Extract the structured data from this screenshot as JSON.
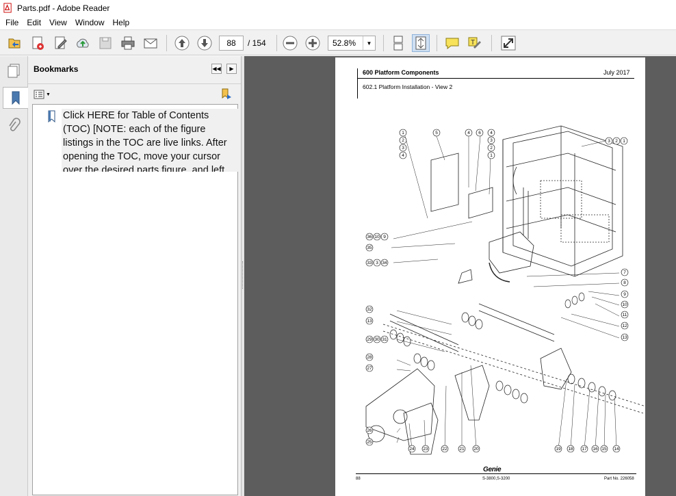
{
  "window": {
    "title": "Parts.pdf - Adobe Reader"
  },
  "menu": [
    "File",
    "Edit",
    "View",
    "Window",
    "Help"
  ],
  "toolbar": {
    "page_current": "88",
    "page_total": "/ 154",
    "zoom": "52.8%",
    "icons": [
      "open-icon",
      "create-pdf-icon",
      "edit-icon",
      "upload-icon",
      "save-icon",
      "print-icon",
      "email-icon",
      "prev-page-icon",
      "next-page-icon",
      "zoom-out-icon",
      "zoom-in-icon",
      "scroll-mode-icon",
      "fit-page-icon",
      "comment-icon",
      "sign-icon",
      "expand-icon"
    ]
  },
  "sidebar": {
    "title": "Bookmarks",
    "bookmark_text": "Click HERE for Table of Contents (TOC) [NOTE: each of the figure listings in the TOC are live links. After opening the TOC, move your cursor over the desired parts figure, and left click to"
  },
  "document": {
    "header_left": "600 Platform Components",
    "header_right": "July 2017",
    "subheader": "602.1 Platform Installation - View 2",
    "footer_left": "88",
    "footer_mid": "S-3800,S-3200",
    "footer_right": "Part No. 226058",
    "brand": "Genie",
    "callouts_top_left": [
      "1",
      "2",
      "3",
      "4"
    ],
    "callouts_top": [
      "5",
      "4",
      "6",
      "4",
      "3",
      "2",
      "1"
    ],
    "callout_top_right": [
      "3",
      "2",
      "1"
    ],
    "callouts_left": [
      "36",
      "10",
      "9",
      "35",
      "33",
      "3",
      "34",
      "32",
      "13",
      "29",
      "30",
      "31",
      "28",
      "27",
      "26",
      "25"
    ],
    "callouts_right": [
      "7",
      "8",
      "9",
      "10",
      "11",
      "12",
      "13"
    ],
    "callouts_bottom": [
      "24",
      "23",
      "22",
      "21",
      "20",
      "19",
      "18",
      "17",
      "16",
      "15",
      "14"
    ]
  }
}
